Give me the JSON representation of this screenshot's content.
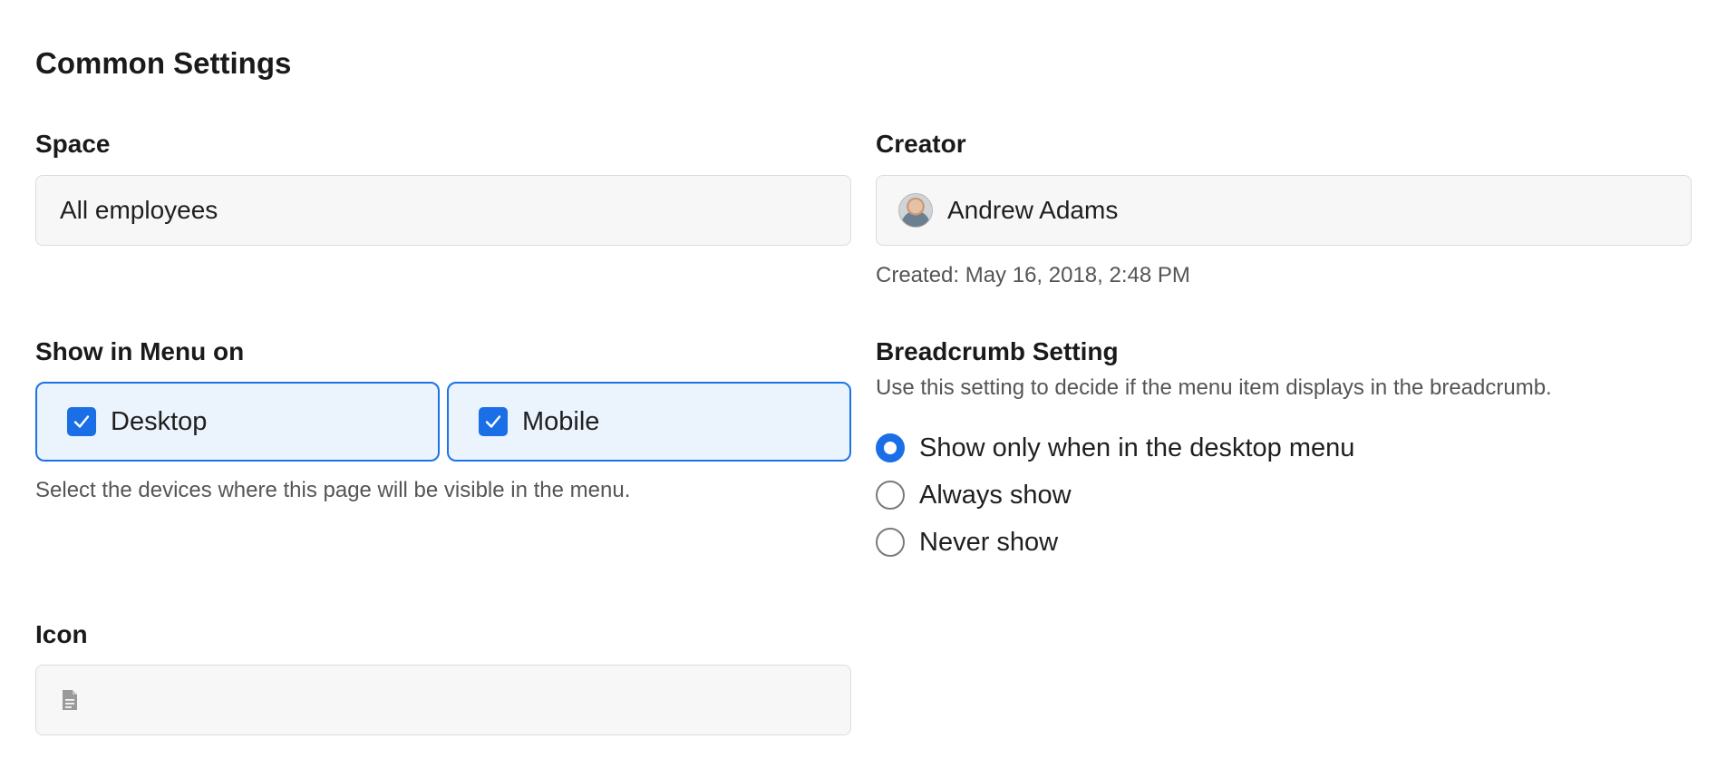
{
  "section_title": "Common Settings",
  "space": {
    "label": "Space",
    "value": "All employees"
  },
  "creator": {
    "label": "Creator",
    "value": "Andrew Adams",
    "avatar_icon": "user-avatar",
    "created_text": "Created: May 16, 2018, 2:48 PM"
  },
  "show_in_menu": {
    "label": "Show in Menu on",
    "options": [
      {
        "label": "Desktop",
        "checked": true
      },
      {
        "label": "Mobile",
        "checked": true
      }
    ],
    "help": "Select the devices where this page will be visible in the menu."
  },
  "breadcrumb": {
    "label": "Breadcrumb Setting",
    "help": "Use this setting to decide if the menu item displays in the breadcrumb.",
    "options": [
      {
        "label": "Show only when in the desktop menu",
        "selected": true
      },
      {
        "label": "Always show",
        "selected": false
      },
      {
        "label": "Never show",
        "selected": false
      }
    ]
  },
  "icon_field": {
    "label": "Icon",
    "icon": "document-icon"
  },
  "colors": {
    "accent": "#1a6fe6",
    "card_bg": "#ebf3fd",
    "field_bg": "#f7f7f7"
  }
}
